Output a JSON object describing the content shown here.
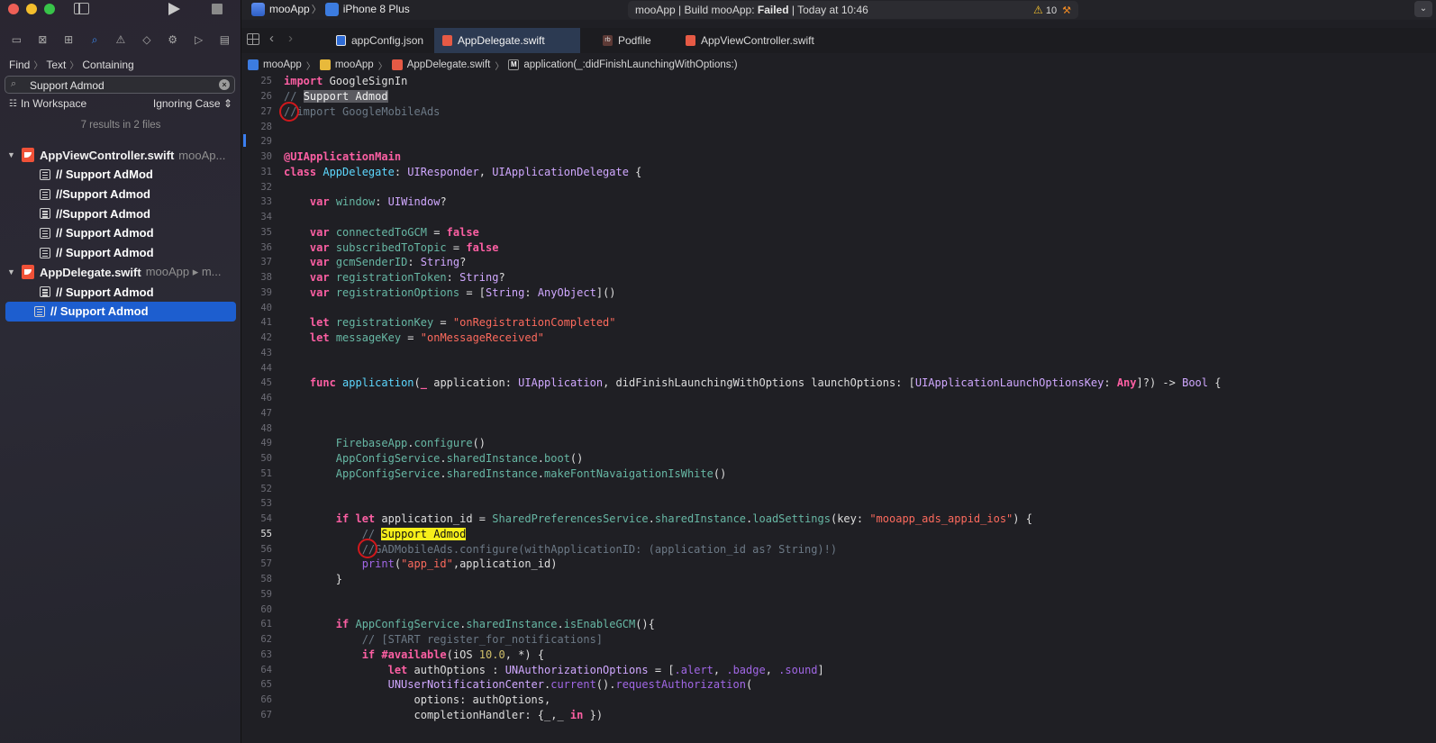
{
  "window": {
    "scheme": {
      "app": "mooApp",
      "device": "iPhone 8 Plus"
    },
    "activity": {
      "prefix": "mooApp | Build mooApp: ",
      "status": "Failed",
      "suffix": " | Today at 10:46",
      "warnings": "10"
    }
  },
  "navigator": {
    "find_path": [
      "Find",
      "Text",
      "Containing"
    ],
    "search_value": "Support Admod",
    "scope": "In Workspace",
    "case_mode": "Ignoring Case",
    "results_count": "7 results in 2 files",
    "files": [
      {
        "name": "AppViewController.swift",
        "path": "mooAp...",
        "matches": [
          "// Support AdMod",
          "//Support Admod",
          "//Support Admod",
          "// Support Admod",
          "// Support Admod"
        ]
      },
      {
        "name": "AppDelegate.swift",
        "path": "mooApp ▸ m...",
        "matches": [
          "// Support Admod",
          "// Support Admod"
        ]
      }
    ]
  },
  "tabs": [
    "appConfig.json",
    "AppDelegate.swift",
    "Podfile",
    "AppViewController.swift"
  ],
  "jumpbar": [
    "mooApp",
    "mooApp",
    "AppDelegate.swift",
    "application(_:didFinishLaunchingWithOptions:)"
  ],
  "code": {
    "line_numbers": [
      "25",
      "26",
      "27",
      "28",
      "29",
      "30",
      "31",
      "32",
      "33",
      "34",
      "35",
      "36",
      "37",
      "38",
      "39",
      "40",
      "41",
      "42",
      "43",
      "44",
      "45",
      "46",
      "47",
      "48",
      "49",
      "50",
      "51",
      "52",
      "53",
      "54",
      "55",
      "56",
      "57",
      "58",
      "59",
      "60",
      "61",
      "62",
      "63",
      "64",
      "65",
      "66",
      "67"
    ],
    "current_line": "55",
    "tokens": {
      "import": "import",
      "googlesignin": "GoogleSignIn",
      "comment_26_prefix": "// ",
      "support_admod": "Support Admod",
      "comment_27_slashes": "//",
      "comment_27_rest": "import GoogleMobileAds",
      "uiapplicationmain": "@UIApplicationMain",
      "class": "class",
      "appdelegate": "AppDelegate",
      "uiresponder": "UIResponder",
      "uiappdelegate": "UIApplicationDelegate",
      "var": "var",
      "let": "let",
      "window": "window",
      "uiwindow": "UIWindow",
      "connectedtogcm": "connectedToGCM",
      "false": "false",
      "subscribedtotopic": "subscribedToTopic",
      "gcmsenderid": "gcmSenderID",
      "string": "String",
      "registrationtoken": "registrationToken",
      "registrationoptions": "registrationOptions",
      "anyobject": "AnyObject",
      "registrationkey": "registrationKey",
      "str_onregcompleted": "\"onRegistrationCompleted\"",
      "messagekey": "messageKey",
      "str_onmsgreceived": "\"onMessageReceived\"",
      "func": "func",
      "application": "application",
      "underscore": "_",
      "application_param": " application: ",
      "uiapplication": "UIApplication",
      "didfinish_rest": ", didFinishLaunchingWithOptions launchOptions: [",
      "uiapplaunchoptionskey": "UIApplicationLaunchOptionsKey",
      "any": "Any",
      "arrow": "]?) -> ",
      "bool": "Bool",
      "firebaseapp": "FirebaseApp",
      "configure": "configure",
      "appconfigservice": "AppConfigService",
      "sharedinstance": "sharedInstance",
      "boot": "boot",
      "makefont": "makeFontNavaigationIsWhite",
      "if": "if",
      "application_id": "application_id",
      "sharedprefs": "SharedPreferencesService",
      "loadsettings": "loadSettings",
      "key_label": "(key: ",
      "str_appid_key": "\"mooapp_ads_appid_ios\"",
      "comment_55_prefix": "// ",
      "comment_56_slashes": "//",
      "comment_56_rest": "GADMobileAds.configure(withApplicationID: (application_id as? String)!)",
      "print": "print",
      "str_app_id": "\"app_id\"",
      "print_rest": ",application_id)",
      "close_brace": "}",
      "isenablegcm": "isEnableGCM",
      "comment_62": "// [START register_for_notifications]",
      "available": "#available",
      "ios": "iOS",
      "ios_ver": "10.0",
      "star_rest": ", *) {",
      "authoptions": "authOptions",
      "unauthoptions": "UNAuthorizationOptions",
      "alert": ".alert",
      "badge": ".badge",
      "sound": ".sound",
      "unusernotificationcenter": "UNUserNotificationCenter",
      "current": "current",
      "requestauthorization": "requestAuthorization",
      "options_label": "options: ",
      "completion_label": "completionHandler: {",
      "in": "in",
      "underscores": "_,_"
    }
  }
}
